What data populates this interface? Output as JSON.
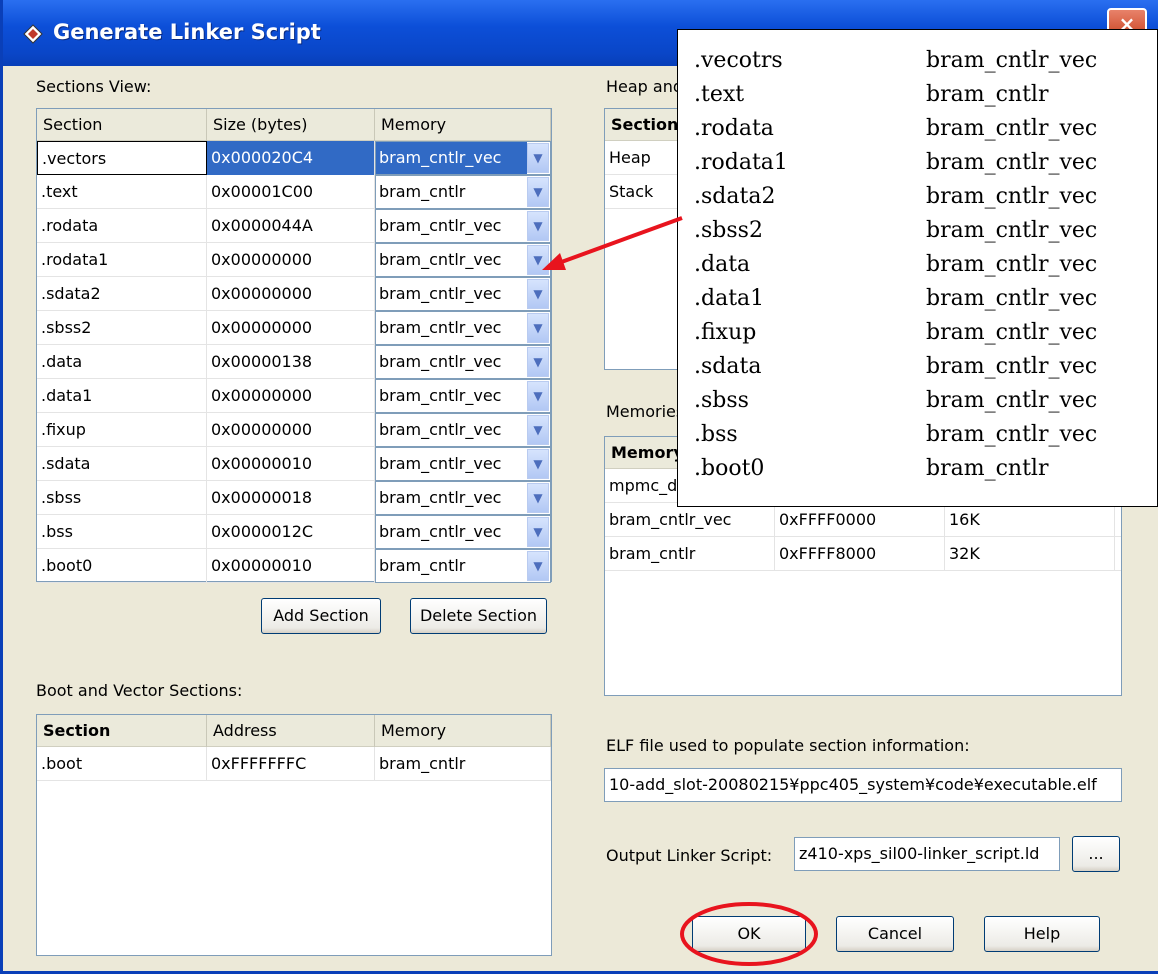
{
  "window": {
    "title": "Generate Linker Script",
    "close": "×"
  },
  "sections_view": {
    "label": "Sections View:",
    "headers": [
      "Section",
      "Size (bytes)",
      "Memory"
    ],
    "rows": [
      {
        "section": ".vectors",
        "size": "0x000020C4",
        "memory": "bram_cntlr_vec"
      },
      {
        "section": ".text",
        "size": "0x00001C00",
        "memory": "bram_cntlr"
      },
      {
        "section": ".rodata",
        "size": "0x0000044A",
        "memory": "bram_cntlr_vec"
      },
      {
        "section": ".rodata1",
        "size": "0x00000000",
        "memory": "bram_cntlr_vec"
      },
      {
        "section": ".sdata2",
        "size": "0x00000000",
        "memory": "bram_cntlr_vec"
      },
      {
        "section": ".sbss2",
        "size": "0x00000000",
        "memory": "bram_cntlr_vec"
      },
      {
        "section": ".data",
        "size": "0x00000138",
        "memory": "bram_cntlr_vec"
      },
      {
        "section": ".data1",
        "size": "0x00000000",
        "memory": "bram_cntlr_vec"
      },
      {
        "section": ".fixup",
        "size": "0x00000000",
        "memory": "bram_cntlr_vec"
      },
      {
        "section": ".sdata",
        "size": "0x00000010",
        "memory": "bram_cntlr_vec"
      },
      {
        "section": ".sbss",
        "size": "0x00000018",
        "memory": "bram_cntlr_vec"
      },
      {
        "section": ".bss",
        "size": "0x0000012C",
        "memory": "bram_cntlr_vec"
      },
      {
        "section": ".boot0",
        "size": "0x00000010",
        "memory": "bram_cntlr"
      }
    ],
    "add_label": "Add Section",
    "delete_label": "Delete Section"
  },
  "boot_vector": {
    "label": "Boot and Vector Sections:",
    "headers": [
      "Section",
      "Address",
      "Memory"
    ],
    "rows": [
      {
        "section": ".boot",
        "address": "0xFFFFFFFC",
        "memory": "bram_cntlr"
      }
    ]
  },
  "heap_stack": {
    "label": "Heap and",
    "header": "Section",
    "rows": [
      "Heap",
      "Stack"
    ]
  },
  "memories": {
    "label": "Memories",
    "header": "Memory",
    "rows": [
      {
        "name": "mpmc_dd",
        "address": "",
        "size": ""
      },
      {
        "name": "bram_cntlr_vec",
        "address": "0xFFFF0000",
        "size": "16K"
      },
      {
        "name": "bram_cntlr",
        "address": "0xFFFF8000",
        "size": "32K"
      }
    ]
  },
  "elf": {
    "label": "ELF file used to populate section information:",
    "value": "10-add_slot-20080215¥ppc405_system¥code¥executable.elf"
  },
  "output": {
    "label": "Output Linker Script:",
    "value": "z410-xps_sil00-linker_script.ld",
    "browse": "..."
  },
  "buttons": {
    "ok": "OK",
    "cancel": "Cancel",
    "help": "Help"
  },
  "annotation_list": [
    {
      "section": ".vecotrs",
      "memory": "bram_cntlr_vec"
    },
    {
      "section": ".text",
      "memory": "bram_cntlr"
    },
    {
      "section": ".rodata",
      "memory": "bram_cntlr_vec"
    },
    {
      "section": ".rodata1",
      "memory": "bram_cntlr_vec"
    },
    {
      "section": ".sdata2",
      "memory": "bram_cntlr_vec"
    },
    {
      "section": ".sbss2",
      "memory": "bram_cntlr_vec"
    },
    {
      "section": ".data",
      "memory": "bram_cntlr_vec"
    },
    {
      "section": ".data1",
      "memory": "bram_cntlr_vec"
    },
    {
      "section": ".fixup",
      "memory": "bram_cntlr_vec"
    },
    {
      "section": ".sdata",
      "memory": "bram_cntlr_vec"
    },
    {
      "section": ".sbss",
      "memory": "bram_cntlr_vec"
    },
    {
      "section": ".bss",
      "memory": "bram_cntlr_vec"
    },
    {
      "section": ".boot0",
      "memory": "bram_cntlr"
    }
  ],
  "colors": {
    "titlebar": "#0c4fd8",
    "highlight": "#316ac5",
    "annotation": "#e8141e"
  }
}
